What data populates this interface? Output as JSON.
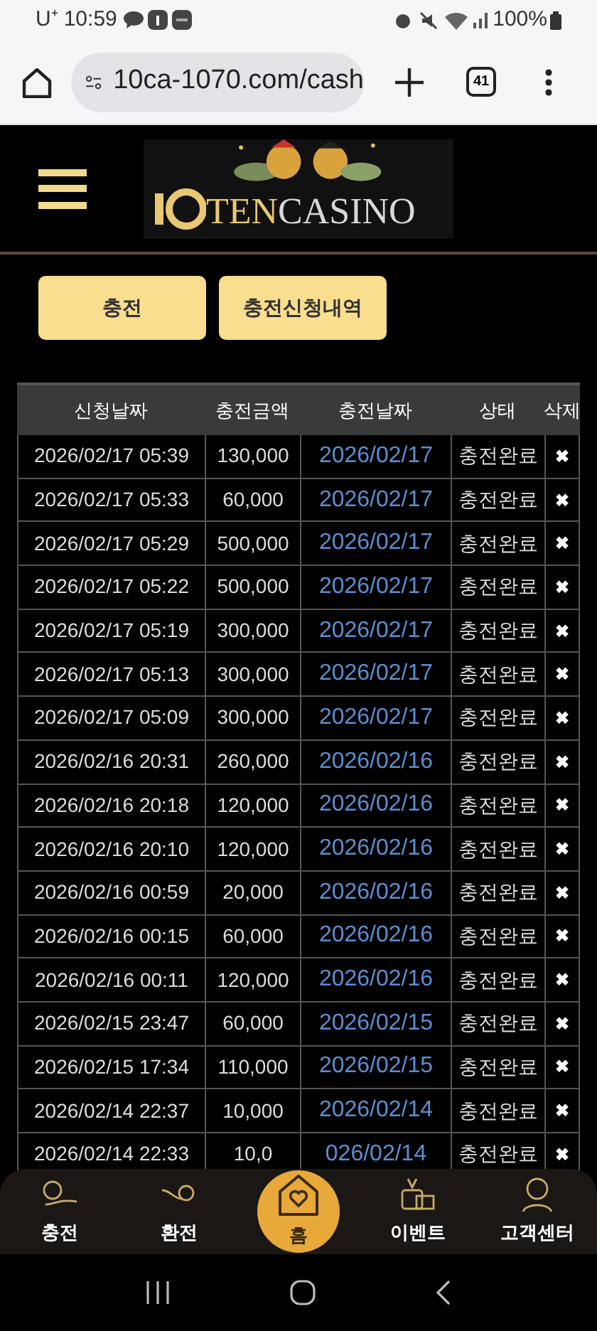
{
  "status_bar": {
    "carrier": "U⁺",
    "time": "10:59",
    "battery": "100%"
  },
  "browser": {
    "url": "10ca-1070.com/cash",
    "tab_count": "41"
  },
  "logo": {
    "word_1": "TEN",
    "word_2": "CASINO"
  },
  "buttons": [
    {
      "label": "충전"
    },
    {
      "label": "충전신청내역"
    }
  ],
  "table": {
    "columns": [
      "신청날짜",
      "충전금액",
      "충전날짜",
      "상태",
      "삭제"
    ],
    "rows": [
      {
        "requested": "2026/02/17 05:39",
        "amount": "130,000",
        "charged": "2026/02/17",
        "status": "충전완료",
        "delete": "✖"
      },
      {
        "requested": "2026/02/17 05:33",
        "amount": "60,000",
        "charged": "2026/02/17",
        "status": "충전완료",
        "delete": "✖"
      },
      {
        "requested": "2026/02/17 05:29",
        "amount": "500,000",
        "charged": "2026/02/17",
        "status": "충전완료",
        "delete": "✖"
      },
      {
        "requested": "2026/02/17 05:22",
        "amount": "500,000",
        "charged": "2026/02/17",
        "status": "충전완료",
        "delete": "✖"
      },
      {
        "requested": "2026/02/17 05:19",
        "amount": "300,000",
        "charged": "2026/02/17",
        "status": "충전완료",
        "delete": "✖"
      },
      {
        "requested": "2026/02/17 05:13",
        "amount": "300,000",
        "charged": "2026/02/17",
        "status": "충전완료",
        "delete": "✖"
      },
      {
        "requested": "2026/02/17 05:09",
        "amount": "300,000",
        "charged": "2026/02/17",
        "status": "충전완료",
        "delete": "✖"
      },
      {
        "requested": "2026/02/16 20:31",
        "amount": "260,000",
        "charged": "2026/02/16",
        "status": "충전완료",
        "delete": "✖"
      },
      {
        "requested": "2026/02/16 20:18",
        "amount": "120,000",
        "charged": "2026/02/16",
        "status": "충전완료",
        "delete": "✖"
      },
      {
        "requested": "2026/02/16 20:10",
        "amount": "120,000",
        "charged": "2026/02/16",
        "status": "충전완료",
        "delete": "✖"
      },
      {
        "requested": "2026/02/16 00:59",
        "amount": "20,000",
        "charged": "2026/02/16",
        "status": "충전완료",
        "delete": "✖"
      },
      {
        "requested": "2026/02/16 00:15",
        "amount": "60,000",
        "charged": "2026/02/16",
        "status": "충전완료",
        "delete": "✖"
      },
      {
        "requested": "2026/02/16 00:11",
        "amount": "120,000",
        "charged": "2026/02/16",
        "status": "충전완료",
        "delete": "✖"
      },
      {
        "requested": "2026/02/15 23:47",
        "amount": "60,000",
        "charged": "2026/02/15",
        "status": "충전완료",
        "delete": "✖"
      },
      {
        "requested": "2026/02/15 17:34",
        "amount": "110,000",
        "charged": "2026/02/15",
        "status": "충전완료",
        "delete": "✖"
      },
      {
        "requested": "2026/02/14 22:37",
        "amount": "10,000",
        "charged": "2026/02/14",
        "status": "충전완료",
        "delete": "✖"
      },
      {
        "requested": "2026/02/14 22:33",
        "amount": "10,0",
        "charged": "026/02/14",
        "status": "충전완료",
        "delete": "✖"
      }
    ]
  },
  "bottom_nav": [
    {
      "label": "충전",
      "kind": "deposit",
      "selected": false
    },
    {
      "label": "환전",
      "kind": "withdraw",
      "selected": false
    },
    {
      "label": "홈",
      "kind": "home",
      "selected": true
    },
    {
      "label": "이벤트",
      "kind": "event",
      "selected": false
    },
    {
      "label": "고객센터",
      "kind": "support",
      "selected": false
    }
  ]
}
